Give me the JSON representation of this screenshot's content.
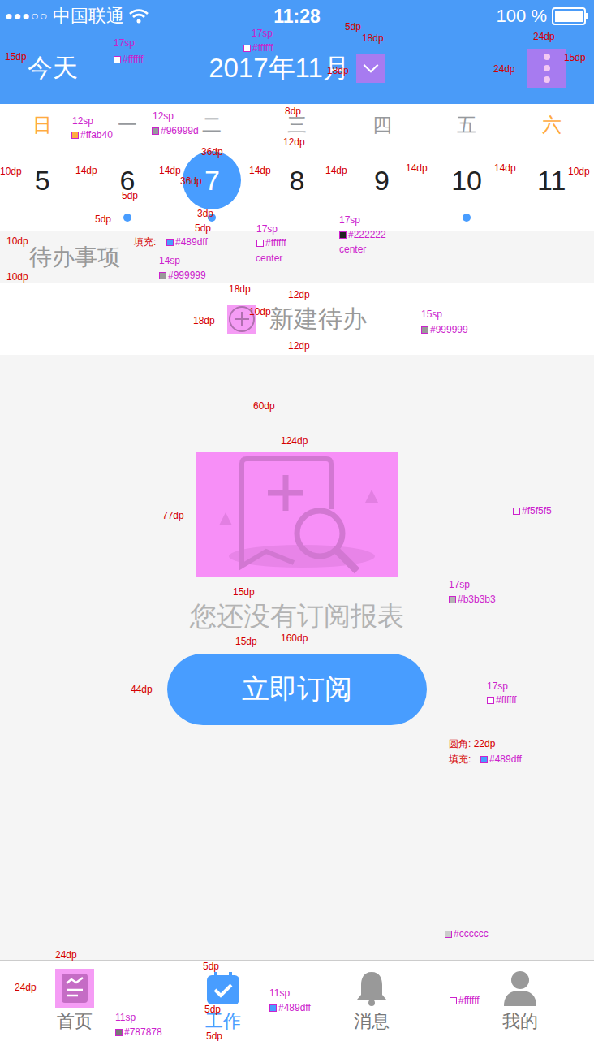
{
  "status_bar": {
    "signal": "●●●○○",
    "carrier": "中国联通",
    "time": "11:28",
    "battery": "100 %"
  },
  "header": {
    "today": "今天",
    "month": "2017年11月"
  },
  "weekdays": [
    {
      "label": "日",
      "weekend": true
    },
    {
      "label": "一",
      "weekend": false
    },
    {
      "label": "二",
      "weekend": false
    },
    {
      "label": "三",
      "weekend": false
    },
    {
      "label": "四",
      "weekend": false
    },
    {
      "label": "五",
      "weekend": false
    },
    {
      "label": "六",
      "weekend": true
    }
  ],
  "dates": [
    {
      "day": "5",
      "selected": false,
      "has_event": false
    },
    {
      "day": "6",
      "selected": false,
      "has_event": true
    },
    {
      "day": "7",
      "selected": true,
      "has_event": true
    },
    {
      "day": "8",
      "selected": false,
      "has_event": false
    },
    {
      "day": "9",
      "selected": false,
      "has_event": false
    },
    {
      "day": "10",
      "selected": false,
      "has_event": true
    },
    {
      "day": "11",
      "selected": false,
      "has_event": false
    }
  ],
  "todo_section": {
    "title": "待办事项",
    "new_button": "新建待办"
  },
  "empty": {
    "message": "您还没有订阅报表",
    "button": "立即订阅"
  },
  "tabs": [
    {
      "label": "首页",
      "selected": false
    },
    {
      "label": "工作",
      "selected": true
    },
    {
      "label": "消息",
      "selected": false
    },
    {
      "label": "我的",
      "selected": false
    }
  ],
  "annotations": [
    {
      "text": "15dp",
      "kind": "dim"
    },
    {
      "text": "17sp",
      "kind": "spec"
    },
    {
      "text": "#ffffff",
      "kind": "swatch"
    },
    {
      "text": "17sp",
      "kind": "spec"
    },
    {
      "text": "#ffffff",
      "kind": "swatch"
    },
    {
      "text": "5dp",
      "kind": "dim"
    },
    {
      "text": "18dp",
      "kind": "dim"
    },
    {
      "text": "18dp",
      "kind": "dim"
    },
    {
      "text": "24dp",
      "kind": "dim"
    },
    {
      "text": "24dp",
      "kind": "dim"
    },
    {
      "text": "15dp",
      "kind": "dim"
    },
    {
      "text": "12sp",
      "kind": "spec"
    },
    {
      "text": "#ffab40",
      "kind": "swatch"
    },
    {
      "text": "12sp",
      "kind": "spec"
    },
    {
      "text": "#96999d",
      "kind": "swatch"
    },
    {
      "text": "8dp",
      "kind": "dim"
    },
    {
      "text": "12dp",
      "kind": "dim"
    },
    {
      "text": "36dp",
      "kind": "dim"
    },
    {
      "text": "36dp",
      "kind": "dim"
    },
    {
      "text": "10dp",
      "kind": "dim"
    },
    {
      "text": "14dp",
      "kind": "dim"
    },
    {
      "text": "14dp",
      "kind": "dim"
    },
    {
      "text": "14dp",
      "kind": "dim"
    },
    {
      "text": "14dp",
      "kind": "dim"
    },
    {
      "text": "14dp",
      "kind": "dim"
    },
    {
      "text": "14dp",
      "kind": "dim"
    },
    {
      "text": "10dp",
      "kind": "dim"
    },
    {
      "text": "5dp",
      "kind": "dim"
    },
    {
      "text": "5dp",
      "kind": "dim"
    },
    {
      "text": "3dp",
      "kind": "dim"
    },
    {
      "text": "5dp",
      "kind": "dim"
    },
    {
      "text": "填充:",
      "kind": "dim"
    },
    {
      "text": "#489dff",
      "kind": "swatch"
    },
    {
      "text": "17sp",
      "kind": "spec"
    },
    {
      "text": "#ffffff",
      "kind": "swatch"
    },
    {
      "text": "center",
      "kind": "spec"
    },
    {
      "text": "17sp",
      "kind": "spec"
    },
    {
      "text": "#222222",
      "kind": "swatch"
    },
    {
      "text": "center",
      "kind": "spec"
    },
    {
      "text": "10dp",
      "kind": "dim"
    },
    {
      "text": "10dp",
      "kind": "dim"
    },
    {
      "text": "14sp",
      "kind": "spec"
    },
    {
      "text": "#999999",
      "kind": "swatch"
    },
    {
      "text": "18dp",
      "kind": "dim"
    },
    {
      "text": "18dp",
      "kind": "dim"
    },
    {
      "text": "10dp",
      "kind": "dim"
    },
    {
      "text": "12dp",
      "kind": "dim"
    },
    {
      "text": "12dp",
      "kind": "dim"
    },
    {
      "text": "15sp",
      "kind": "spec"
    },
    {
      "text": "#999999",
      "kind": "swatch"
    },
    {
      "text": "60dp",
      "kind": "dim"
    },
    {
      "text": "124dp",
      "kind": "dim"
    },
    {
      "text": "77dp",
      "kind": "dim"
    },
    {
      "text": "#f5f5f5",
      "kind": "swatch"
    },
    {
      "text": "15dp",
      "kind": "dim"
    },
    {
      "text": "17sp",
      "kind": "spec"
    },
    {
      "text": "#b3b3b3",
      "kind": "swatch"
    },
    {
      "text": "15dp",
      "kind": "dim"
    },
    {
      "text": "160dp",
      "kind": "dim"
    },
    {
      "text": "44dp",
      "kind": "dim"
    },
    {
      "text": "17sp",
      "kind": "spec"
    },
    {
      "text": "#ffffff",
      "kind": "swatch"
    },
    {
      "text": "圆角:  22dp",
      "kind": "dim"
    },
    {
      "text": "填充:",
      "kind": "dim"
    },
    {
      "text": "#489dff",
      "kind": "swatch"
    },
    {
      "text": "#cccccc",
      "kind": "swatch"
    },
    {
      "text": "24dp",
      "kind": "dim"
    },
    {
      "text": "24dp",
      "kind": "dim"
    },
    {
      "text": "5dp",
      "kind": "dim"
    },
    {
      "text": "5dp",
      "kind": "dim"
    },
    {
      "text": "5dp",
      "kind": "dim"
    },
    {
      "text": "11sp",
      "kind": "spec"
    },
    {
      "text": "#489dff",
      "kind": "swatch"
    },
    {
      "text": "11sp",
      "kind": "spec"
    },
    {
      "text": "#787878",
      "kind": "swatch"
    },
    {
      "text": "#ffffff",
      "kind": "swatch"
    }
  ]
}
